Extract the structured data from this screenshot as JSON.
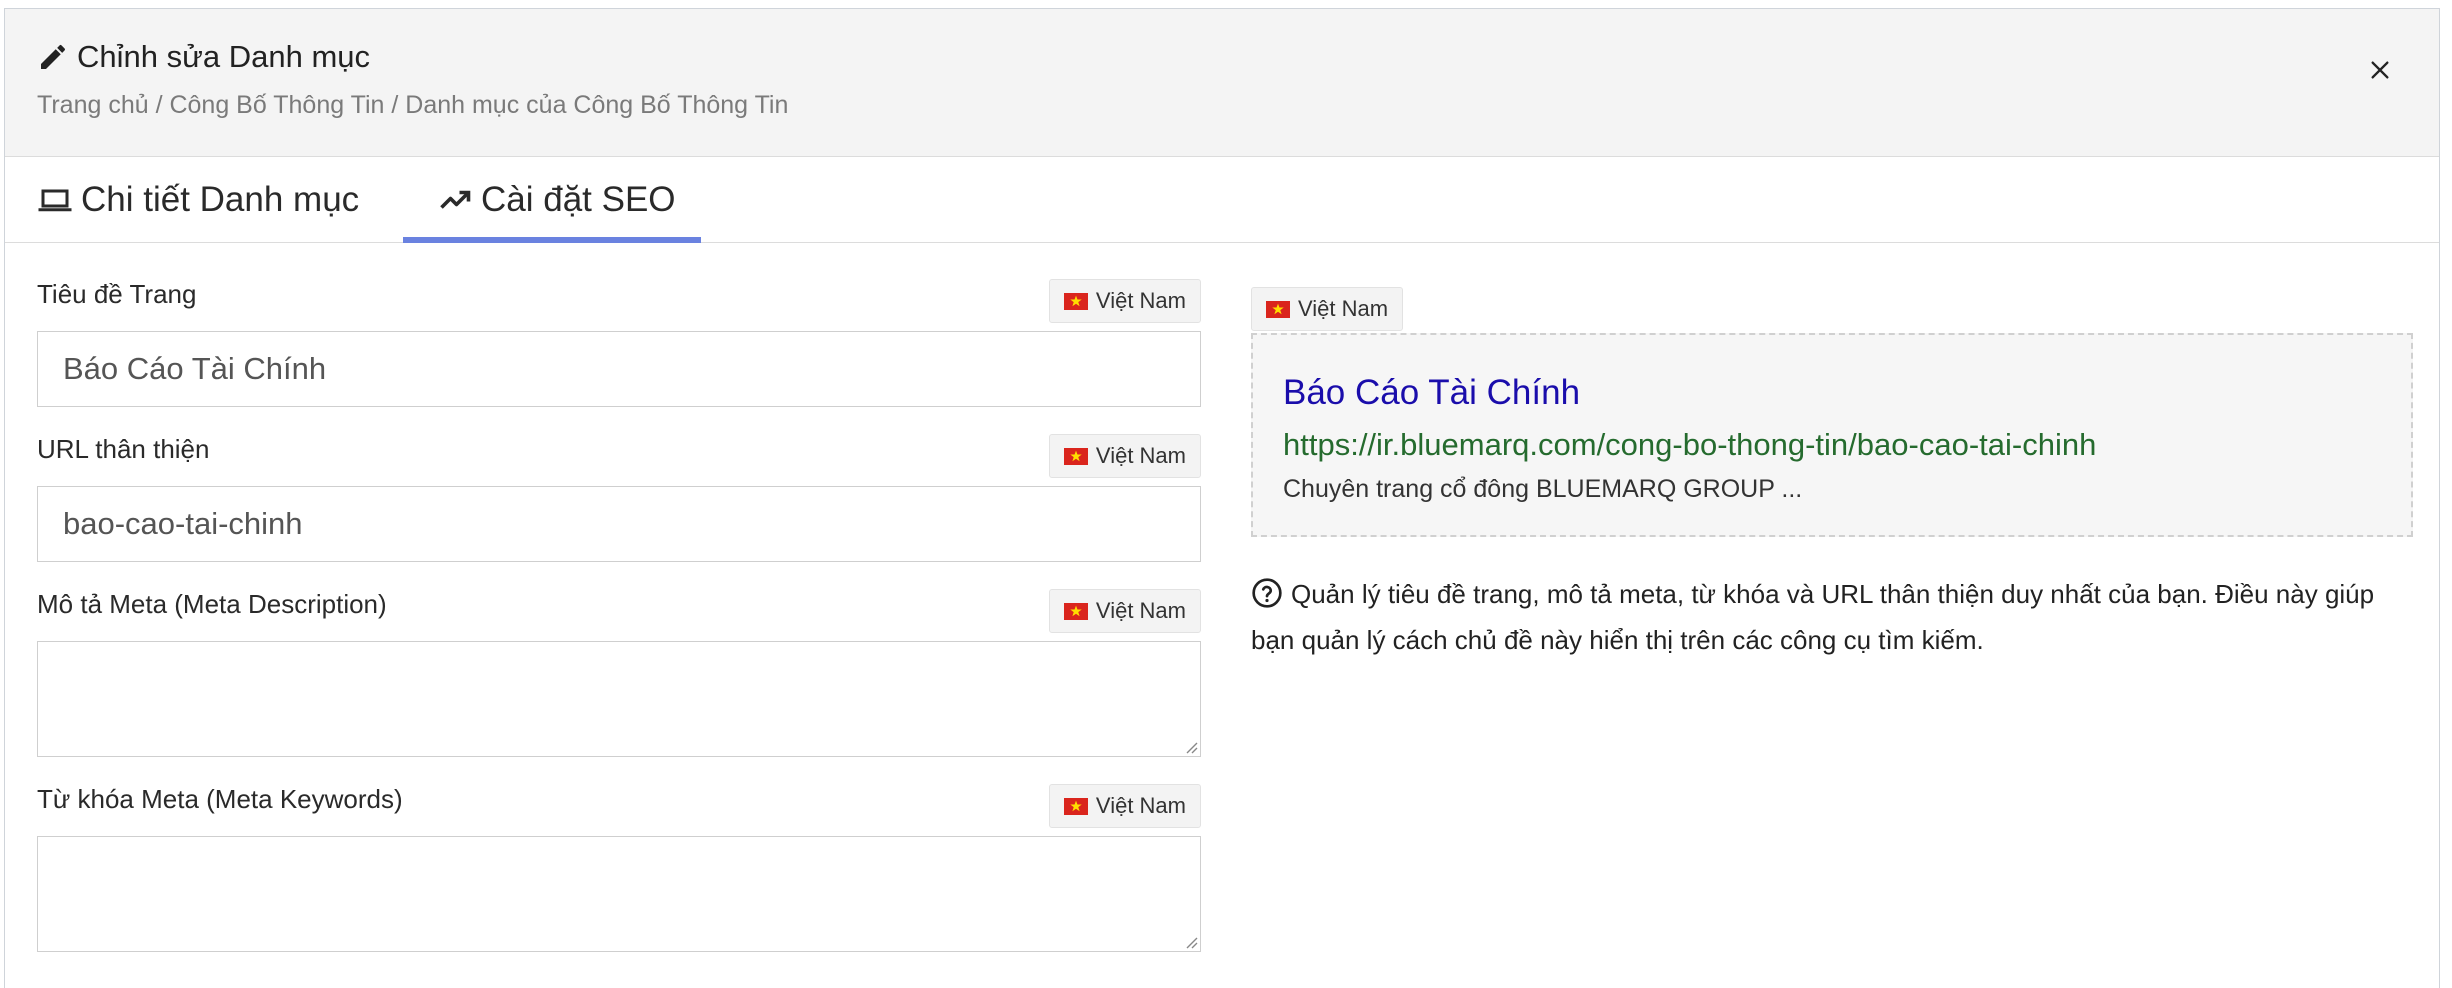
{
  "header": {
    "title": "Chỉnh sửa Danh mục",
    "breadcrumb": "Trang chủ / Công Bố Thông Tin / Danh mục của Công Bố Thông Tin"
  },
  "tabs": [
    {
      "label": "Chi tiết Danh mục",
      "icon": "laptop-icon",
      "active": false
    },
    {
      "label": "Cài đặt SEO",
      "icon": "trending-up-icon",
      "active": true
    }
  ],
  "accent_color": "#6a82e0",
  "form": {
    "page_title": {
      "label": "Tiêu đề Trang",
      "lang": "Việt Nam",
      "value": "Báo Cáo Tài Chính"
    },
    "friendly_url": {
      "label": "URL thân thiện",
      "lang": "Việt Nam",
      "value": "bao-cao-tai-chinh"
    },
    "meta_description": {
      "label": "Mô tả Meta (Meta Description)",
      "lang": "Việt Nam",
      "value": ""
    },
    "meta_keywords": {
      "label": "Từ khóa Meta (Meta Keywords)",
      "lang": "Việt Nam",
      "value": ""
    }
  },
  "preview": {
    "lang": "Việt Nam",
    "title": "Báo Cáo Tài Chính",
    "url": "https://ir.bluemarq.com/cong-bo-thong-tin/bao-cao-tai-chinh",
    "description": "Chuyên trang cổ đông BLUEMARQ GROUP ...",
    "title_color": "#1a0dab",
    "url_color": "#256b2e"
  },
  "help_text": "Quản lý tiêu đề trang, mô tả meta, từ khóa và URL thân thiện duy nhất của bạn. Điều này giúp bạn quản lý cách chủ đề này hiển thị trên các công cụ tìm kiếm."
}
